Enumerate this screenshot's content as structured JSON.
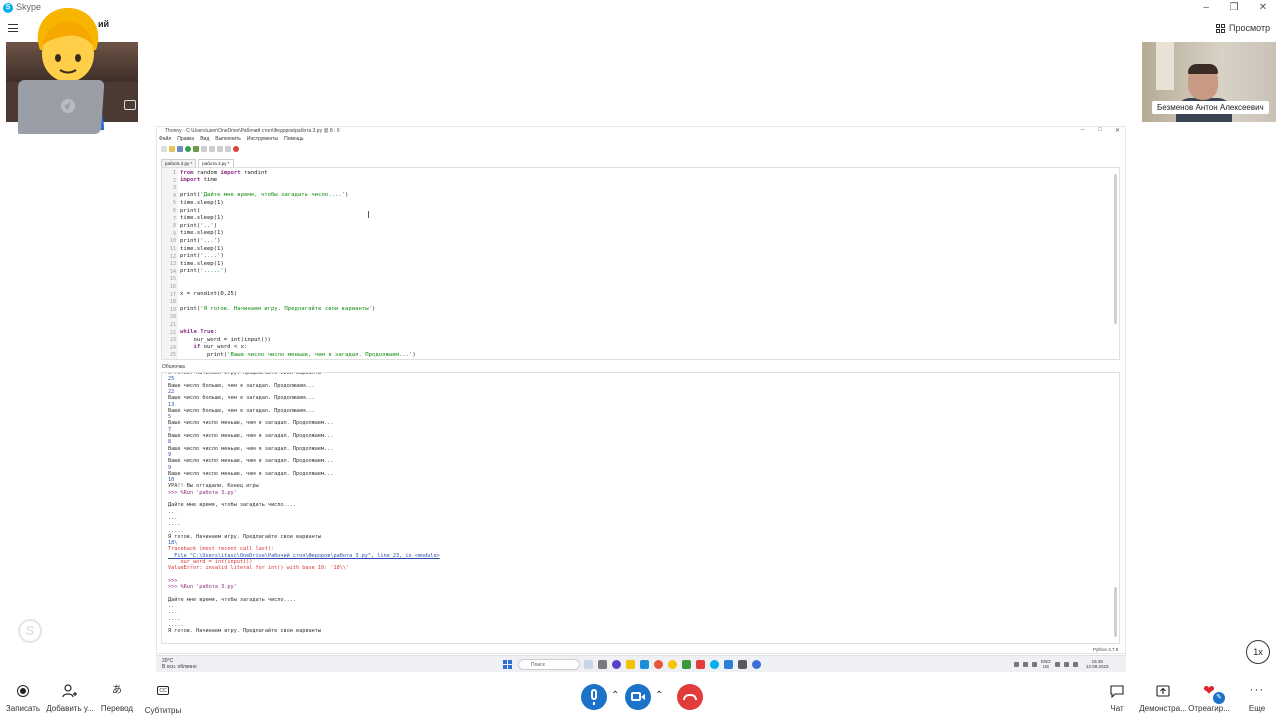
{
  "window": {
    "title": "Skype"
  },
  "call": {
    "title": "ий",
    "view_label": "Просмотр"
  },
  "participants": {
    "remote_name": "Безменов Антон Алексеевич"
  },
  "thonny": {
    "title": "Thonny - C:\\Users\\user\\OneDrive\\Рабочий стол\\Федоров\\работа 3.py @ 8 : 6",
    "menu": [
      "Файл",
      "Правка",
      "Вид",
      "Выполнить",
      "Инструменты",
      "Помощь"
    ],
    "tabs": [
      "работа 2.py *",
      "работа 3.py *"
    ],
    "code": [
      {
        "n": "1",
        "t": [
          [
            "kw",
            "from"
          ],
          [
            "",
            " random "
          ],
          [
            "kw",
            "import"
          ],
          [
            "",
            " randint"
          ]
        ]
      },
      {
        "n": "2",
        "t": [
          [
            "kw",
            "import"
          ],
          [
            "",
            " time"
          ]
        ]
      },
      {
        "n": "3",
        "t": []
      },
      {
        "n": "4",
        "t": [
          [
            "",
            "print("
          ],
          [
            "str",
            "'Дайте мне время, чтобы загадать число....'"
          ],
          [
            "",
            ")"
          ]
        ]
      },
      {
        "n": "5",
        "t": [
          [
            "",
            "time.sleep(1)"
          ]
        ]
      },
      {
        "n": "6",
        "t": [
          [
            "",
            "print("
          ]
        ]
      },
      {
        "n": "7",
        "t": [
          [
            "",
            "time.sleep(1)"
          ]
        ]
      },
      {
        "n": "8",
        "t": [
          [
            "",
            "print("
          ],
          [
            "str",
            "'..'"
          ],
          [
            "",
            ")"
          ]
        ]
      },
      {
        "n": "9",
        "t": [
          [
            "",
            "time.sleep(1)"
          ]
        ]
      },
      {
        "n": "10",
        "t": [
          [
            "",
            "print("
          ],
          [
            "str",
            "'...'"
          ],
          [
            "",
            ")"
          ]
        ]
      },
      {
        "n": "11",
        "t": [
          [
            "",
            "time.sleep(1)"
          ]
        ]
      },
      {
        "n": "12",
        "t": [
          [
            "",
            "print("
          ],
          [
            "str",
            "'....'"
          ],
          [
            "",
            ")"
          ]
        ]
      },
      {
        "n": "13",
        "t": [
          [
            "",
            "time.sleep(1)"
          ]
        ]
      },
      {
        "n": "14",
        "t": [
          [
            "",
            "print("
          ],
          [
            "str",
            "'.....'"
          ],
          [
            "",
            ")"
          ]
        ]
      },
      {
        "n": "15",
        "t": []
      },
      {
        "n": "16",
        "t": []
      },
      {
        "n": "17",
        "t": [
          [
            "",
            "x = randint(0,25)"
          ]
        ]
      },
      {
        "n": "18",
        "t": []
      },
      {
        "n": "19",
        "t": [
          [
            "",
            "print("
          ],
          [
            "str",
            "'Я готов. Начинаем игру. Предлагайте свои варианты'"
          ],
          [
            "",
            ")"
          ]
        ]
      },
      {
        "n": "20",
        "t": []
      },
      {
        "n": "21",
        "t": []
      },
      {
        "n": "22",
        "t": [
          [
            "kw",
            "while"
          ],
          [
            "",
            " "
          ],
          [
            "kw",
            "True"
          ],
          [
            "",
            ":"
          ]
        ]
      },
      {
        "n": "23",
        "t": [
          [
            "",
            "    our_word = int(input())"
          ]
        ]
      },
      {
        "n": "24",
        "t": [
          [
            "",
            "    "
          ],
          [
            "kw",
            "if"
          ],
          [
            "",
            " our_word < x:"
          ]
        ]
      },
      {
        "n": "25",
        "t": [
          [
            "",
            "        print("
          ],
          [
            "str",
            "'Ваше число число меньше, чем я загадал. Продолжаем...'"
          ],
          [
            "",
            ")"
          ]
        ]
      }
    ],
    "shell_label": "Оболочка",
    "shell": [
      {
        "c": "",
        "t": "Я готов. Начинаем игру. Предлагайте свои варианты"
      },
      {
        "c": "num",
        "t": "25"
      },
      {
        "c": "",
        "t": "Ваше число больше, чем я загадал. Продолжаем..."
      },
      {
        "c": "num",
        "t": "22"
      },
      {
        "c": "",
        "t": "Ваше число больше, чем я загадал. Продолжаем..."
      },
      {
        "c": "num",
        "t": "13"
      },
      {
        "c": "",
        "t": "Ваше число больше, чем я загадал. Продолжаем..."
      },
      {
        "c": "num",
        "t": "5"
      },
      {
        "c": "",
        "t": "Ваше число число меньше, чем я загадал. Продолжаем..."
      },
      {
        "c": "num",
        "t": "7"
      },
      {
        "c": "",
        "t": "Ваше число число меньше, чем я загадал. Продолжаем..."
      },
      {
        "c": "num",
        "t": "8"
      },
      {
        "c": "",
        "t": "Ваше число число меньше, чем я загадал. Продолжаем..."
      },
      {
        "c": "num",
        "t": "9"
      },
      {
        "c": "",
        "t": "Ваше число число меньше, чем я загадал. Продолжаем..."
      },
      {
        "c": "num",
        "t": "9"
      },
      {
        "c": "",
        "t": "Ваше число число меньше, чем я загадал. Продолжаем..."
      },
      {
        "c": "num",
        "t": "10"
      },
      {
        "c": "",
        "t": "УРА!! Вы отгадали. Конец игры"
      },
      {
        "c": "prompt",
        "t": ">>> %Run 'работа 3.py'"
      },
      {
        "c": "",
        "t": ""
      },
      {
        "c": "",
        "t": "Дайте мне время, чтобы загадать число...."
      },
      {
        "c": "",
        "t": ".."
      },
      {
        "c": "",
        "t": "..."
      },
      {
        "c": "",
        "t": "...."
      },
      {
        "c": "",
        "t": "....."
      },
      {
        "c": "",
        "t": "Я готов. Начинаем игру. Предлагайте свои варианты"
      },
      {
        "c": "num",
        "t": "18\\"
      },
      {
        "c": "err",
        "t": "Traceback (most recent call last):"
      },
      {
        "c": "link",
        "t": "  File \"C:\\Users\\itasc\\OneDrive\\Рабочий стол\\Федоров\\работа 3.py\", line 23, in <module>"
      },
      {
        "c": "err",
        "t": "    our_word = int(input())"
      },
      {
        "c": "err",
        "t": "ValueError: invalid literal for int() with base 10: '18\\\\'"
      },
      {
        "c": "",
        "t": ""
      },
      {
        "c": "prompt",
        "t": ">>>"
      },
      {
        "c": "prompt",
        "t": ">>> %Run 'работа 3.py'"
      },
      {
        "c": "",
        "t": ""
      },
      {
        "c": "",
        "t": "Дайте мне время, чтобы загадать число...."
      },
      {
        "c": "",
        "t": ".."
      },
      {
        "c": "",
        "t": "..."
      },
      {
        "c": "",
        "t": "...."
      },
      {
        "c": "",
        "t": "....."
      },
      {
        "c": "",
        "t": "Я готов. Начинаем игру. Предлагайте свои варианты"
      }
    ],
    "status": "Python 3.7.9"
  },
  "taskbar": {
    "weather_temp": "20°C",
    "weather_desc": "В осн. облачно",
    "search_placeholder": "Поиск",
    "lang": "ENG",
    "lang2": "US",
    "time": "16:48",
    "date": "12.09.2023"
  },
  "controls": {
    "speed": "1x",
    "record": "Записать",
    "add_user": "Добавить у...",
    "translate": "Перевод",
    "subtitles": "Субтитры",
    "chat": "Чат",
    "share": "Демонстра...",
    "react": "Отреагир...",
    "more": "Еще"
  },
  "colors": {
    "call_blue": "#1a73c8",
    "hangup_red": "#e23b3b",
    "skype_blue": "#00aff0"
  }
}
